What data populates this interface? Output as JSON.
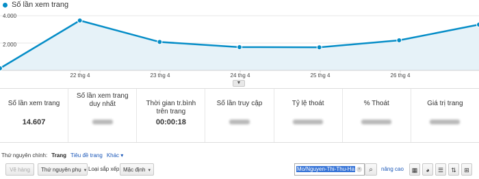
{
  "chart_data": {
    "type": "area",
    "series": [
      {
        "name": "Số lần xem trang",
        "values": [
          150,
          3650,
          2080,
          1700,
          1690,
          2200,
          3350
        ]
      }
    ],
    "x_tick_labels": [
      "22 thg 4",
      "23 thg 4",
      "24 thg 4",
      "25 thg 4",
      "26 thg 4"
    ],
    "y_tick_labels": [
      "4.000",
      "2.000"
    ],
    "ylim": [
      0,
      4400
    ],
    "color": "#058dc7",
    "fill": "#e6f2f8"
  },
  "legend": {
    "label": "Số lần xem trang",
    "color": "#058dc7"
  },
  "collapse_handle": "▼",
  "metrics": [
    {
      "label": "Số lần xem trang",
      "value": "14.607",
      "hidden": false
    },
    {
      "label": "Số lần xem trang duy nhất",
      "value": "",
      "hidden": true
    },
    {
      "label": "Thời gian tr.bình trên trang",
      "value": "00:00:18",
      "hidden": false
    },
    {
      "label": "Số lần truy cập",
      "value": "",
      "hidden": true
    },
    {
      "label": "Tỷ lệ thoát",
      "value": "",
      "hidden": true
    },
    {
      "label": "% Thoát",
      "value": "",
      "hidden": true
    },
    {
      "label": "Giá trị trang",
      "value": "",
      "hidden": true
    }
  ],
  "dimension": {
    "label": "Thứ nguyên chính:",
    "active": "Trang",
    "alt": "Tiêu đề trang",
    "other": "Khác",
    "other_caret": "▾"
  },
  "toolbar": {
    "plot_rows": "Vẽ hàng",
    "secondary_dimension": "Thứ nguyên phụ",
    "sort_label": "Loại sắp xếp:",
    "sort_value": "Mặc định",
    "caret": "▾",
    "search_value": "Mo/Nguyen-Thi-Thu-Ha",
    "clear_glyph": "×",
    "search_glyph": "⌕",
    "advanced": "nâng cao",
    "views": [
      {
        "name": "data-table-view-button",
        "glyph": "▦"
      },
      {
        "name": "percentage-pie-view-button",
        "glyph": "◕"
      },
      {
        "name": "performance-bar-view-button",
        "glyph": "☰"
      },
      {
        "name": "comparison-view-button",
        "glyph": "⇅"
      },
      {
        "name": "pivot-view-button",
        "glyph": "⊞"
      }
    ]
  }
}
